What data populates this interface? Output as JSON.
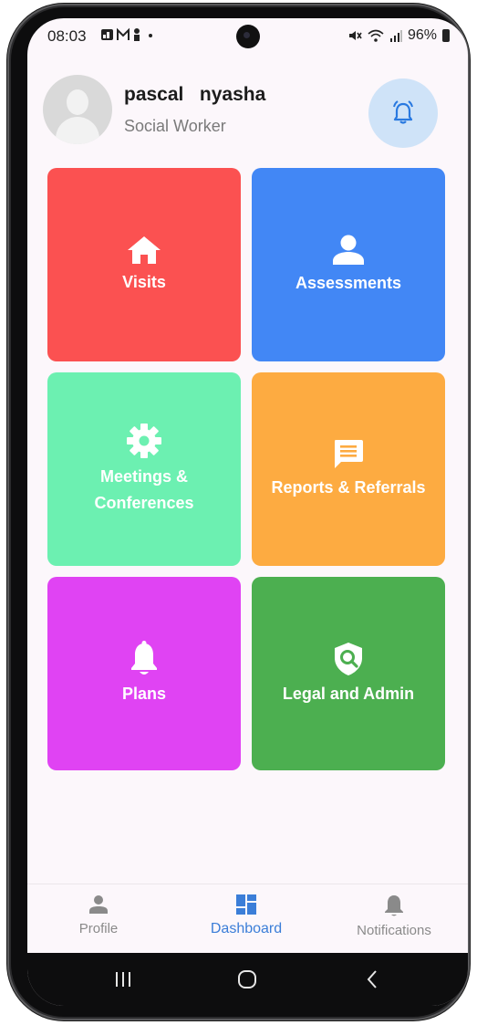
{
  "status_bar": {
    "time": "08:03",
    "left_icons": "🖾 M ♟ •",
    "battery": "96%"
  },
  "user": {
    "name": "pascal   nyasha",
    "role": "Social Worker"
  },
  "tiles": [
    {
      "label": "Visits",
      "icon": "home-icon",
      "color": "#fb5151"
    },
    {
      "label": "Assessments",
      "icon": "person-icon",
      "color": "#4287f5"
    },
    {
      "label": "Meetings & Conferences",
      "icon": "gear-icon",
      "color": "#6cf0b1"
    },
    {
      "label": "Reports & Referrals",
      "icon": "message-icon",
      "color": "#fdab41"
    },
    {
      "label": "Plans",
      "icon": "bell-icon",
      "color": "#e043f3"
    },
    {
      "label": "Legal and Admin",
      "icon": "shield-search-icon",
      "color": "#4caf50"
    }
  ],
  "bottom_nav": {
    "items": [
      {
        "label": "Profile",
        "icon": "person-icon"
      },
      {
        "label": "Dashboard",
        "icon": "dashboard-icon",
        "active": true
      },
      {
        "label": "Notifications",
        "icon": "bell-icon"
      }
    ]
  },
  "colors": {
    "accent": "#3b7ed8",
    "background": "#fcf7fb",
    "alarm_button": "#cfe3f8"
  }
}
